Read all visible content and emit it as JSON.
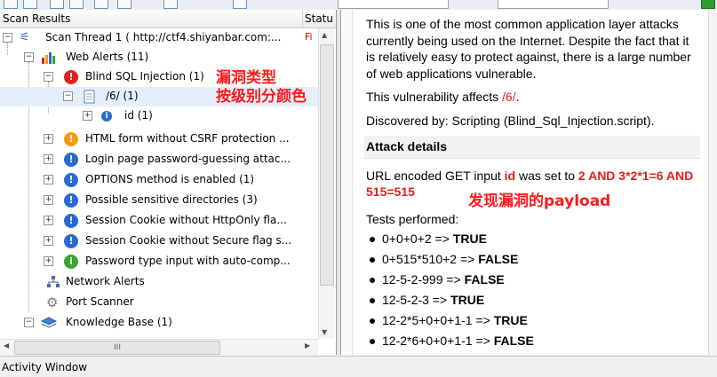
{
  "columns": {
    "scan_results": "Scan Results",
    "status": "Statu"
  },
  "tree": [
    {
      "label": "Scan Thread 1 ( http://ctf4.shiyanbar.com:...",
      "icon": "scan-thread-icon",
      "expander": "−",
      "status": "Fi"
    },
    {
      "label": "Web Alerts (11)",
      "icon": "web-alerts-icon",
      "expander": "−"
    },
    {
      "label": "Blind SQL Injection (1)",
      "icon": "alert-high-icon",
      "expander": "−"
    },
    {
      "label": "/6/ (1)",
      "icon": "page-icon",
      "expander": "−"
    },
    {
      "label": "id (1)",
      "icon": "parameter-icon",
      "expander": "+"
    },
    {
      "label": "HTML form without CSRF protection ...",
      "icon": "alert-medium-icon",
      "expander": "+"
    },
    {
      "label": "Login page password-guessing attac...",
      "icon": "alert-low-icon",
      "expander": "+"
    },
    {
      "label": "OPTIONS method is enabled (1)",
      "icon": "alert-low-icon",
      "expander": "+"
    },
    {
      "label": "Possible sensitive directories (3)",
      "icon": "alert-low-icon",
      "expander": "+"
    },
    {
      "label": "Session Cookie without HttpOnly fla...",
      "icon": "alert-low-icon",
      "expander": "+"
    },
    {
      "label": "Session Cookie without Secure flag s...",
      "icon": "alert-low-icon",
      "expander": "+"
    },
    {
      "label": "Password type input with auto-comp...",
      "icon": "alert-info-icon",
      "expander": "+"
    },
    {
      "label": "Network Alerts",
      "icon": "network-alerts-icon"
    },
    {
      "label": "Port Scanner",
      "icon": "port-scanner-icon"
    },
    {
      "label": "Knowledge Base (1)",
      "icon": "knowledge-base-icon",
      "expander": "−"
    }
  ],
  "alert_glyph": "!",
  "info_glyph": "i",
  "hscroll_thumb": "III",
  "annotations": {
    "vuln_type_line1": "漏洞类型",
    "vuln_type_line2": "按级别分颜色",
    "payload_found": "发现漏洞的payload"
  },
  "detail": {
    "intro": "This is one of the most common application layer attacks currently being used on the Internet. Despite the fact that it is relatively easy to protect against, there is a large number of web applications vulnerable.",
    "affects_prefix": "This vulnerability affects ",
    "affects_path": "/6/",
    "affects_suffix": ".",
    "discovered": "Discovered by: Scripting (Blind_Sql_Injection.script).",
    "attack_details_header": "Attack details",
    "url_prefix": "URL encoded GET input ",
    "url_param": "id",
    "url_mid": " was set to ",
    "url_value": "2 AND 3*2*1=6 AND 515=515",
    "tests_header": "Tests performed:",
    "tests": [
      {
        "expr": "0+0+0+2 => ",
        "result": "TRUE"
      },
      {
        "expr": "0+515*510+2 => ",
        "result": "FALSE"
      },
      {
        "expr": "12-5-2-999 => ",
        "result": "FALSE"
      },
      {
        "expr": "12-5-2-3 => ",
        "result": "TRUE"
      },
      {
        "expr": "12-2*5+0+0+1-1 => ",
        "result": "TRUE"
      },
      {
        "expr": "12-2*6+0+0+1-1 => ",
        "result": "FALSE"
      }
    ]
  },
  "activity_window": "Activity Window",
  "colors": {
    "alert_high": "#e0211b",
    "alert_medium": "#f39c12",
    "alert_low": "#2a6ad0",
    "alert_info": "#3aa52f",
    "annotation": "#ff1a1a"
  }
}
